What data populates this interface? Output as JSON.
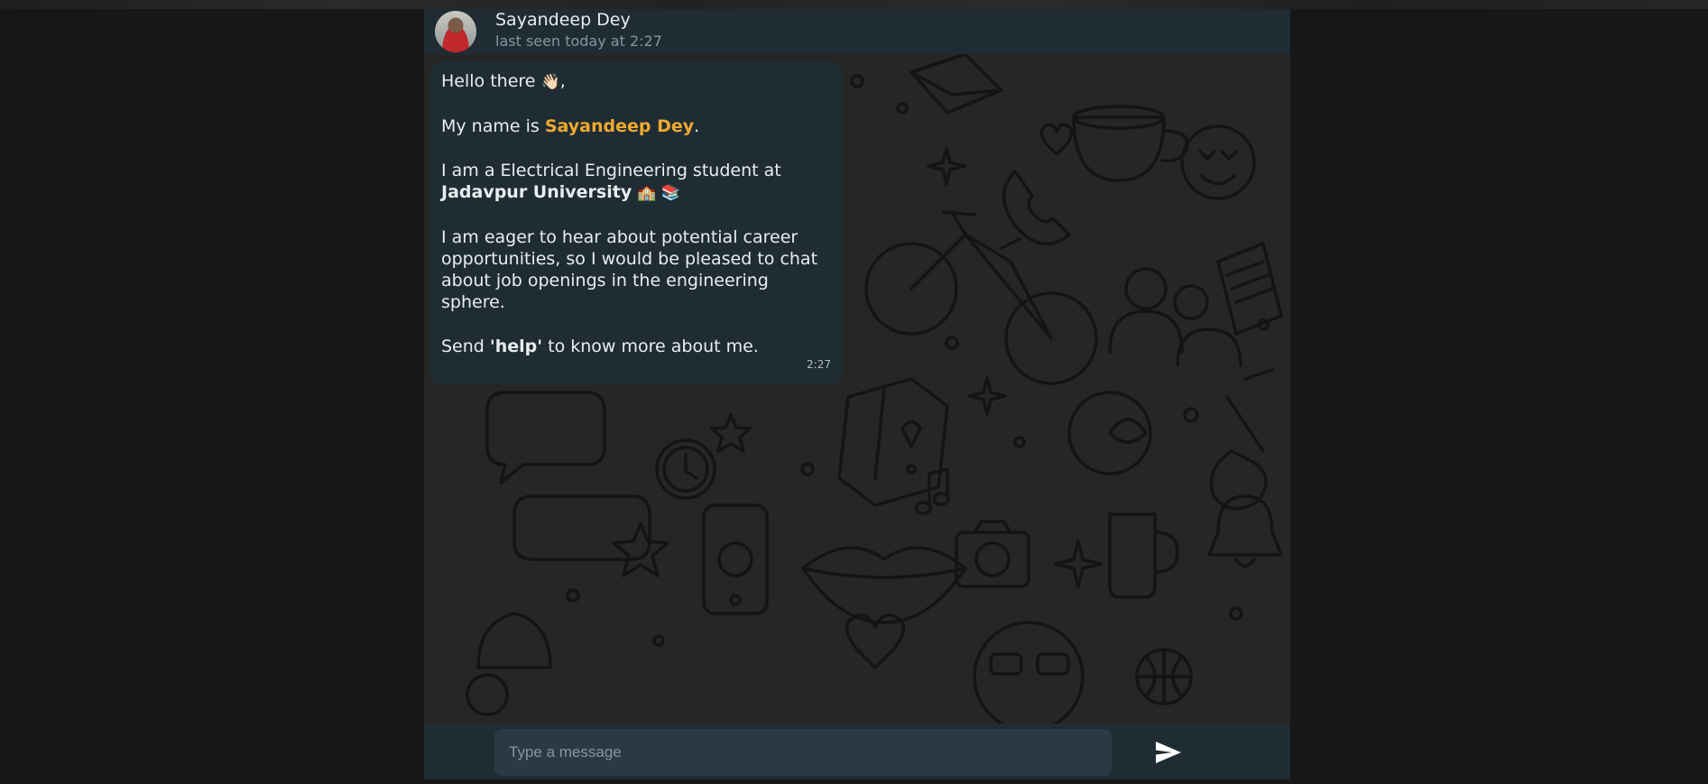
{
  "header": {
    "contact_name": "Sayandeep Dey",
    "status": "last seen today at 2:27",
    "avatar_icon": "profile-photo"
  },
  "message": {
    "greeting": "Hello there",
    "greeting_emoji": "👋🏻",
    "greeting_punct": ",",
    "intro_prefix": "My name is ",
    "intro_name": "Sayandeep Dey",
    "intro_suffix": ".",
    "study_prefix": "I am a Electrical Engineering student at ",
    "study_university": "Jadavpur University",
    "study_emojis": "🏫 📚",
    "career_text": "I am eager to hear about potential career opportunities, so I would be pleased to chat about job openings in the engineering sphere.",
    "help_prefix": "Send ",
    "help_keyword": "'help'",
    "help_suffix": " to know more about me.",
    "time": "2:27"
  },
  "composer": {
    "placeholder": "Type a message",
    "value": "",
    "send_icon": "send-icon"
  },
  "colors": {
    "page_background": "#171717",
    "panel": "#1f2c34",
    "input_background": "#2a3942",
    "highlight": "#f0a92e",
    "text": "#e9edef",
    "muted_text": "#8696a0"
  }
}
